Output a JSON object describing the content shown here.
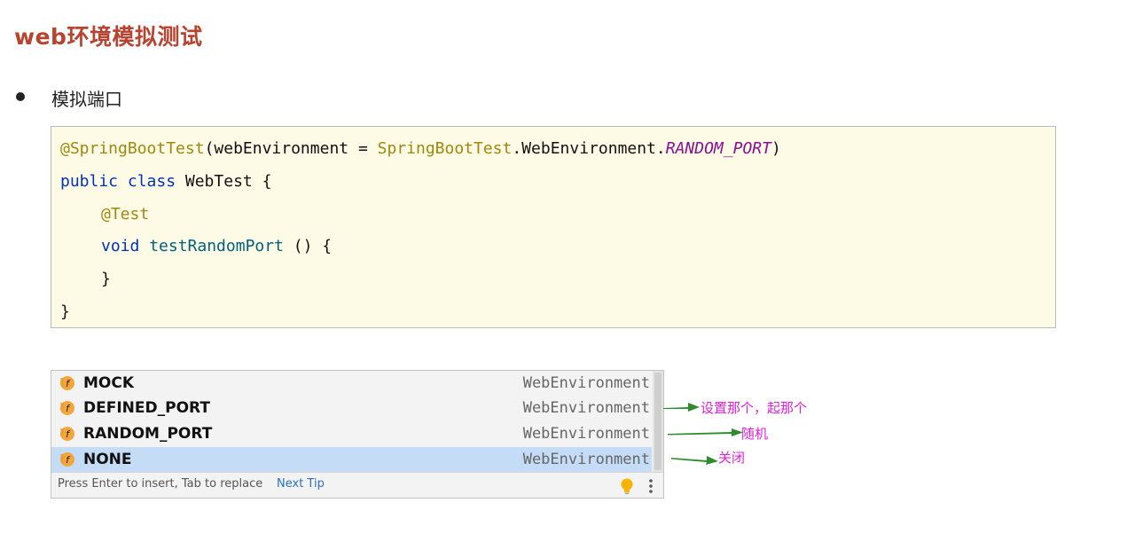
{
  "page": {
    "title": "web环境模拟测试",
    "bullet_text": "模拟端口"
  },
  "code": {
    "line1": {
      "annotation": "@SpringBootTest",
      "open": "(webEnvironment = ",
      "class_ref": "SpringBootTest",
      "mid": ".WebEnvironment.",
      "constant": "RANDOM_PORT",
      "close": ")"
    },
    "line2": {
      "kw": "public class",
      "rest": " WebTest {"
    },
    "line3": {
      "annotation": "@Test"
    },
    "line4": {
      "kw": "void",
      "method": "testRandomPort",
      "rest": " () {"
    },
    "line5": {
      "text": "}"
    },
    "line6": {
      "text": "}"
    }
  },
  "completion": {
    "items": [
      {
        "name": "MOCK",
        "type": "WebEnvironment",
        "icon": "field-icon",
        "selected": false
      },
      {
        "name": "DEFINED_PORT",
        "type": "WebEnvironment",
        "icon": "field-icon",
        "selected": false
      },
      {
        "name": "RANDOM_PORT",
        "type": "WebEnvironment",
        "icon": "field-icon",
        "selected": false
      },
      {
        "name": "NONE",
        "type": "WebEnvironment",
        "icon": "field-icon",
        "selected": true
      }
    ],
    "footer_hint": "Press Enter to insert, Tab to replace",
    "next_tip": "Next Tip",
    "icons": [
      "lightbulb-icon",
      "more-vertical-icon"
    ]
  },
  "annotations": {
    "defined_port_note": "设置那个，起那个",
    "random_port_note": "随机",
    "none_note": "关闭",
    "arrow_color": "#2e8b2e",
    "note_color": "#e020d8"
  },
  "colors": {
    "title": "#b8432f",
    "code_bg": "#fdfbe5",
    "selected_row": "#c5dcf6",
    "annotation_token": "#9e880d",
    "keyword_token": "#0033b3",
    "constant_token": "#871094"
  }
}
